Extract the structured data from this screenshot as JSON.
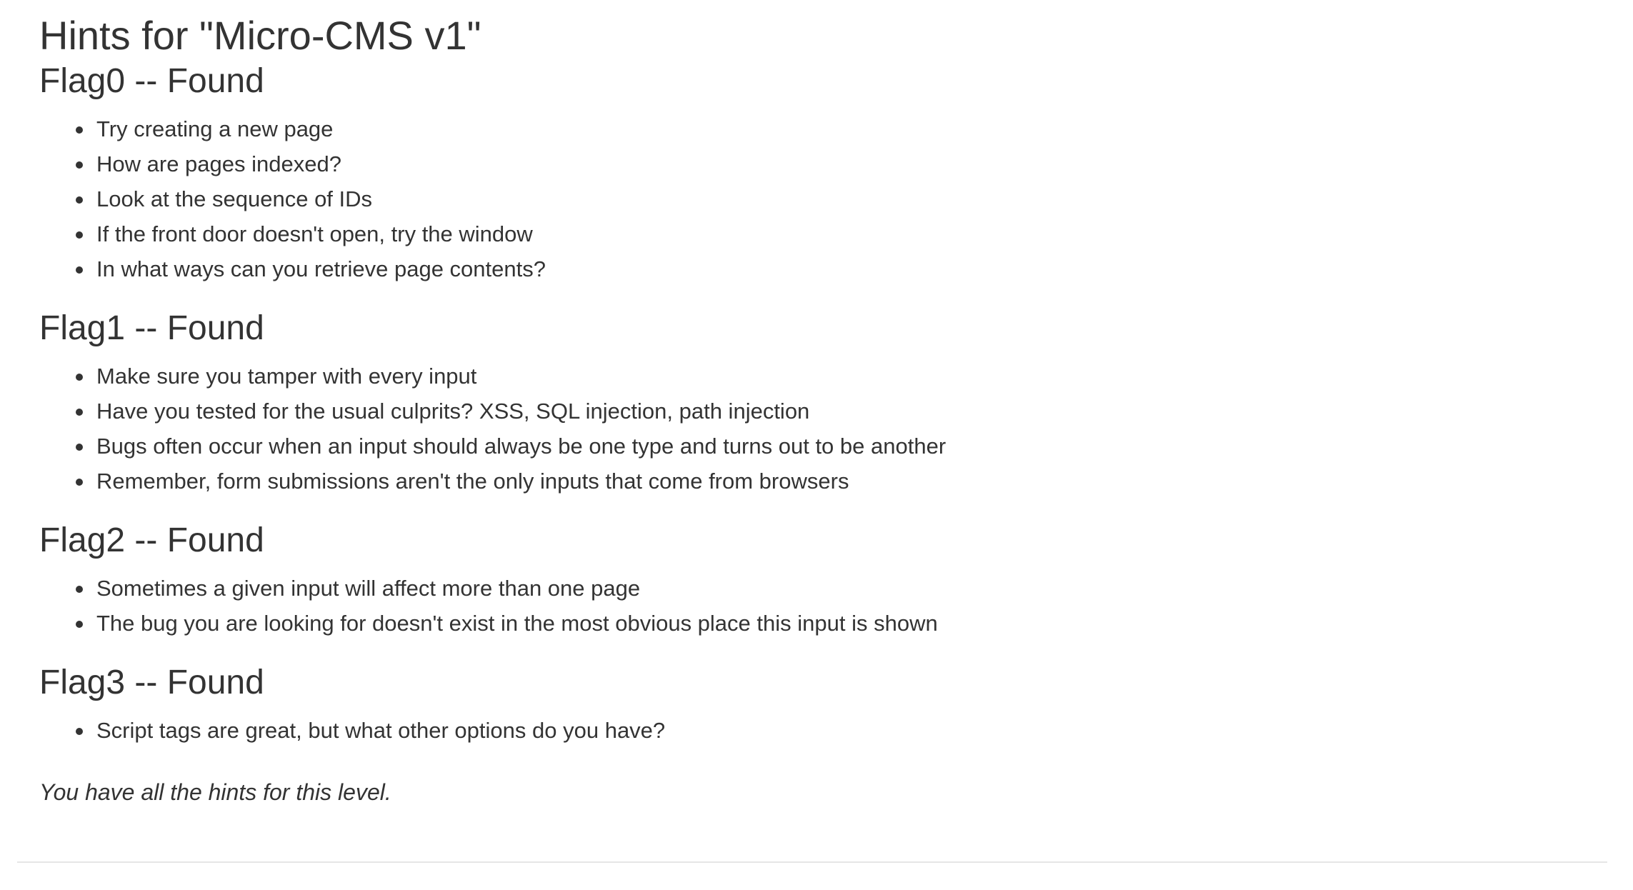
{
  "title": "Hints for \"Micro-CMS v1\"",
  "flags": [
    {
      "heading": "Flag0 -- Found",
      "hints": [
        "Try creating a new page",
        "How are pages indexed?",
        "Look at the sequence of IDs",
        "If the front door doesn't open, try the window",
        "In what ways can you retrieve page contents?"
      ]
    },
    {
      "heading": "Flag1 -- Found",
      "hints": [
        "Make sure you tamper with every input",
        "Have you tested for the usual culprits? XSS, SQL injection, path injection",
        "Bugs often occur when an input should always be one type and turns out to be another",
        "Remember, form submissions aren't the only inputs that come from browsers"
      ]
    },
    {
      "heading": "Flag2 -- Found",
      "hints": [
        "Sometimes a given input will affect more than one page",
        "The bug you are looking for doesn't exist in the most obvious place this input is shown"
      ]
    },
    {
      "heading": "Flag3 -- Found",
      "hints": [
        "Script tags are great, but what other options do you have?"
      ]
    }
  ],
  "footer_note": "You have all the hints for this level."
}
